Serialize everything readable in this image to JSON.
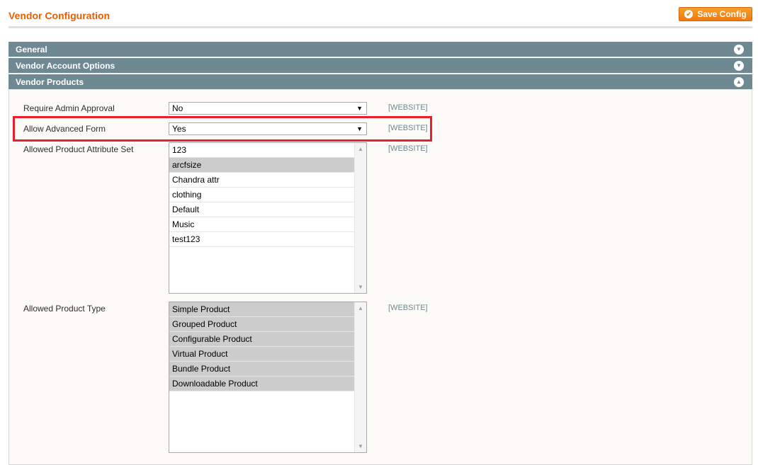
{
  "page": {
    "title": "Vendor Configuration",
    "save_label": "Save Config"
  },
  "sections": [
    {
      "label": "General",
      "state": "collapsed"
    },
    {
      "label": "Vendor Account Options",
      "state": "collapsed"
    },
    {
      "label": "Vendor Products",
      "state": "expanded"
    }
  ],
  "fields": {
    "require_admin_approval": {
      "label": "Require Admin Approval",
      "value": "No",
      "scope": "[WEBSITE]"
    },
    "allow_advanced_form": {
      "label": "Allow Advanced Form",
      "value": "Yes",
      "scope": "[WEBSITE]"
    },
    "allowed_attribute_set": {
      "label": "Allowed Product Attribute Set",
      "scope": "[WEBSITE]",
      "options": [
        {
          "label": "123",
          "selected": false
        },
        {
          "label": "arcfsize",
          "selected": true
        },
        {
          "label": "Chandra attr",
          "selected": false
        },
        {
          "label": "clothing",
          "selected": false
        },
        {
          "label": "Default",
          "selected": false
        },
        {
          "label": "Music",
          "selected": false
        },
        {
          "label": "test123",
          "selected": false
        }
      ]
    },
    "allowed_product_type": {
      "label": "Allowed Product Type",
      "scope": "[WEBSITE]",
      "options": [
        {
          "label": "Simple Product",
          "selected": true
        },
        {
          "label": "Grouped Product",
          "selected": true
        },
        {
          "label": "Configurable Product",
          "selected": true
        },
        {
          "label": "Virtual Product",
          "selected": true
        },
        {
          "label": "Bundle Product",
          "selected": true
        },
        {
          "label": "Downloadable Product",
          "selected": true
        }
      ]
    }
  },
  "colors": {
    "accent": "#eb5e00",
    "section_header": "#6f8992",
    "highlight": "#e8202e"
  },
  "icons": {
    "save": "check-circle-icon",
    "collapsed": "chevron-down-circle-icon",
    "expanded": "chevron-up-circle-icon"
  }
}
